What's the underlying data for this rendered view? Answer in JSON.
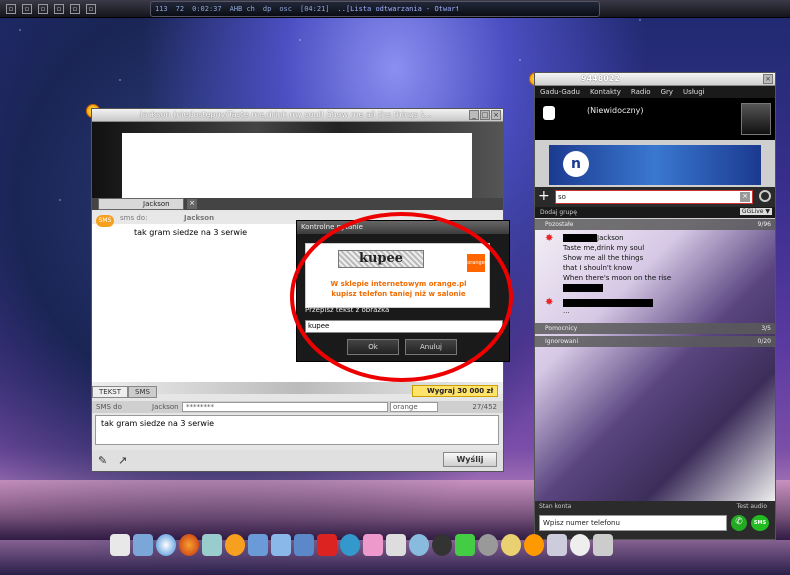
{
  "top_bar": {
    "player": {
      "stats": [
        "113",
        "72",
        "0:02:37",
        "AHB ch",
        "dp",
        "osc"
      ],
      "time": "[04:21]",
      "track": "..[Lista odtwarzania - Otwart..."
    }
  },
  "chat_window": {
    "title": "Jackson (niedostępny/Taste me,drink my soul! Show me all the things t...",
    "tab_label": "Jackson",
    "sms_to_label": "sms do:",
    "sms_to_name": "Jackson",
    "conversation_text": "tak gram siedze na 3 serwie",
    "mode_text": "TEKST",
    "mode_sms": "SMS",
    "promo_button": "Wygraj 30 000 zł",
    "sms_row": {
      "sms_label": "SMS do",
      "recipient": "Jackson",
      "number_masked": "********",
      "operator": "orange",
      "char_counter": "27/452"
    },
    "input_text": "tak gram siedze na 3 serwie",
    "send_button": "Wyślij"
  },
  "captcha_dialog": {
    "title": "Kontrolne pytanie",
    "captcha_word": "kupee",
    "ad_logo": "orange",
    "ad_line1": "W sklepie internetowym orange.pl",
    "ad_line2": "kupisz telefon taniej niż w salonie",
    "prompt_label": "Przepisz tekst z obrazka",
    "input_value": "kupee",
    "ok_button": "Ok",
    "cancel_button": "Anuluj"
  },
  "gg_window": {
    "title": "9448022",
    "menu": [
      "Gadu-Gadu",
      "Kontakty",
      "Radio",
      "Gry",
      "Usługi"
    ],
    "status": "(Niewidoczny)",
    "search_value": "so",
    "add_group": "Dodaj grupę",
    "live_selector": "GGLive ▼",
    "groups": [
      {
        "name": "Pozostałe",
        "count": "9/96"
      },
      {
        "name": "Pomocnicy",
        "count": "3/5"
      },
      {
        "name": "Ignorowani",
        "count": "0/20"
      }
    ],
    "contact": {
      "name": "Jackson",
      "description_lines": [
        "Taste me,drink my soul",
        "Show me all the things",
        "that I shouln't know",
        "When there's moon on the rise"
      ],
      "second_line": "..."
    },
    "account_label": "Stan konta",
    "test_audio": "Test audio",
    "phone_placeholder": "Wpisz numer telefonu",
    "sms_button": "SMS"
  },
  "colors": {
    "accent_orange": "#f26b00",
    "highlight_ring": "#e00000",
    "promo_yellow": "#ffe36b"
  }
}
